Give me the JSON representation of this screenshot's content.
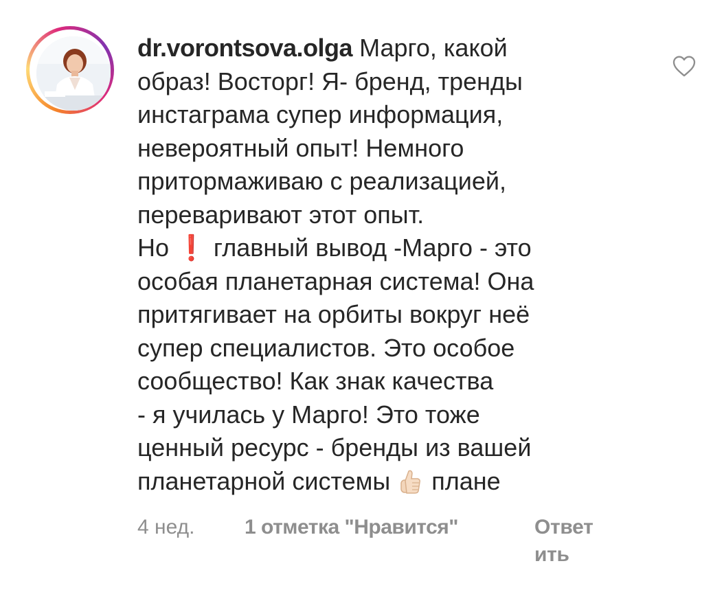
{
  "comment": {
    "username": "dr.vorontsova.olga",
    "text_part1": " Марго, какой\nобраз! Восторг! Я- бренд, тренды\nинстаграма супер информация,\nневероятный опыт! Немного\nпритормаживаю с реализацией,\nпереваривают этот опыт.\nНо ",
    "exclamation_emoji": "❗",
    "text_part2": " главный вывод -Марго - это\nособая планетарная система! Она\nпритягивает на орбиты вокруг неё\nсупер специалистов. Это особое\nсообщество! Как знак качества\n- я училась у Марго! Это тоже\nценный ресурс - бренды из вашей\nпланетарной системы ",
    "thumb_icon": "thumbs-up-emoji",
    "text_part3": " плане"
  },
  "meta": {
    "time": "4 нед.",
    "likes": "1 отметка \"Нравится\"",
    "reply": "Ответ\nить"
  },
  "icons": {
    "like": "heart-outline-icon",
    "avatar": "profile-photo"
  },
  "colors": {
    "text": "#262626",
    "meta": "#8e8e8e",
    "ring_orange": "#f58529",
    "ring_pink": "#dd2a7b",
    "ring_purple": "#8134af"
  }
}
